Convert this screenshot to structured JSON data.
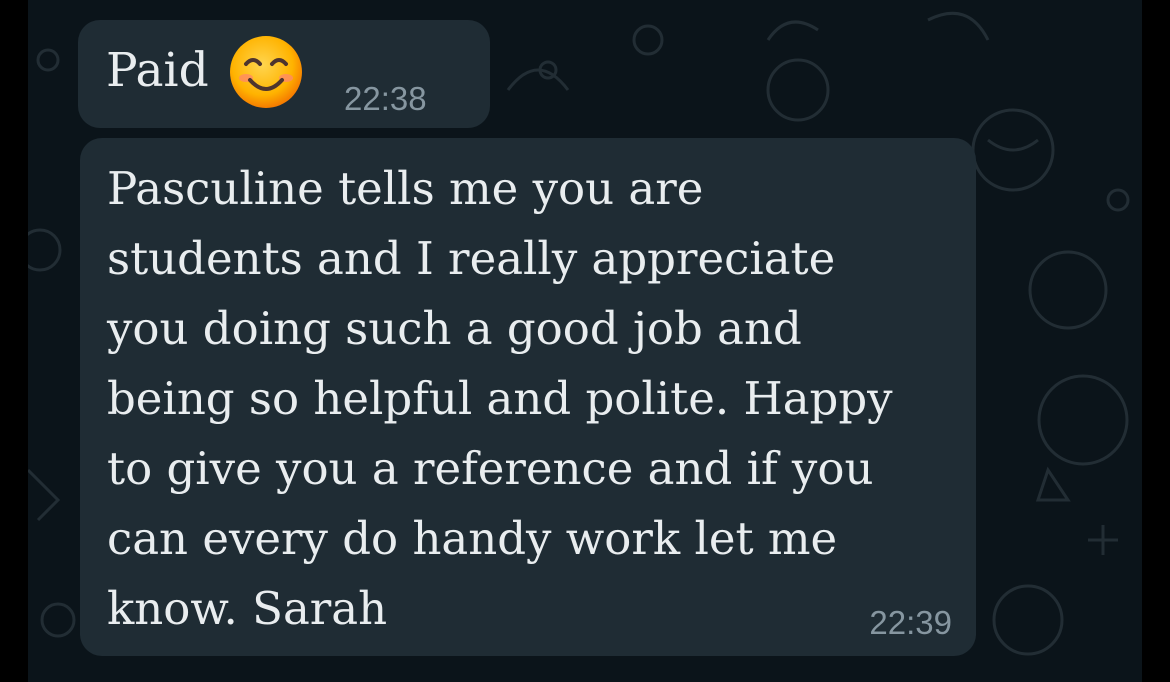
{
  "messages": [
    {
      "text": "Paid",
      "emoji": "smiling-face-with-smiling-eyes",
      "time": "22:38"
    },
    {
      "lines": [
        "Pasculine tells me you are",
        "students and I really appreciate",
        "you doing such a good job and",
        "being so helpful and polite. Happy",
        "to give you a reference and if you",
        "can every do handy work let me",
        "know. Sarah"
      ],
      "time": "22:39"
    }
  ],
  "colors": {
    "background": "#0b141a",
    "bubble": "#1f2c34",
    "text": "#e9edef",
    "timestamp": "#8696a0",
    "doodle": "#2a3942"
  }
}
